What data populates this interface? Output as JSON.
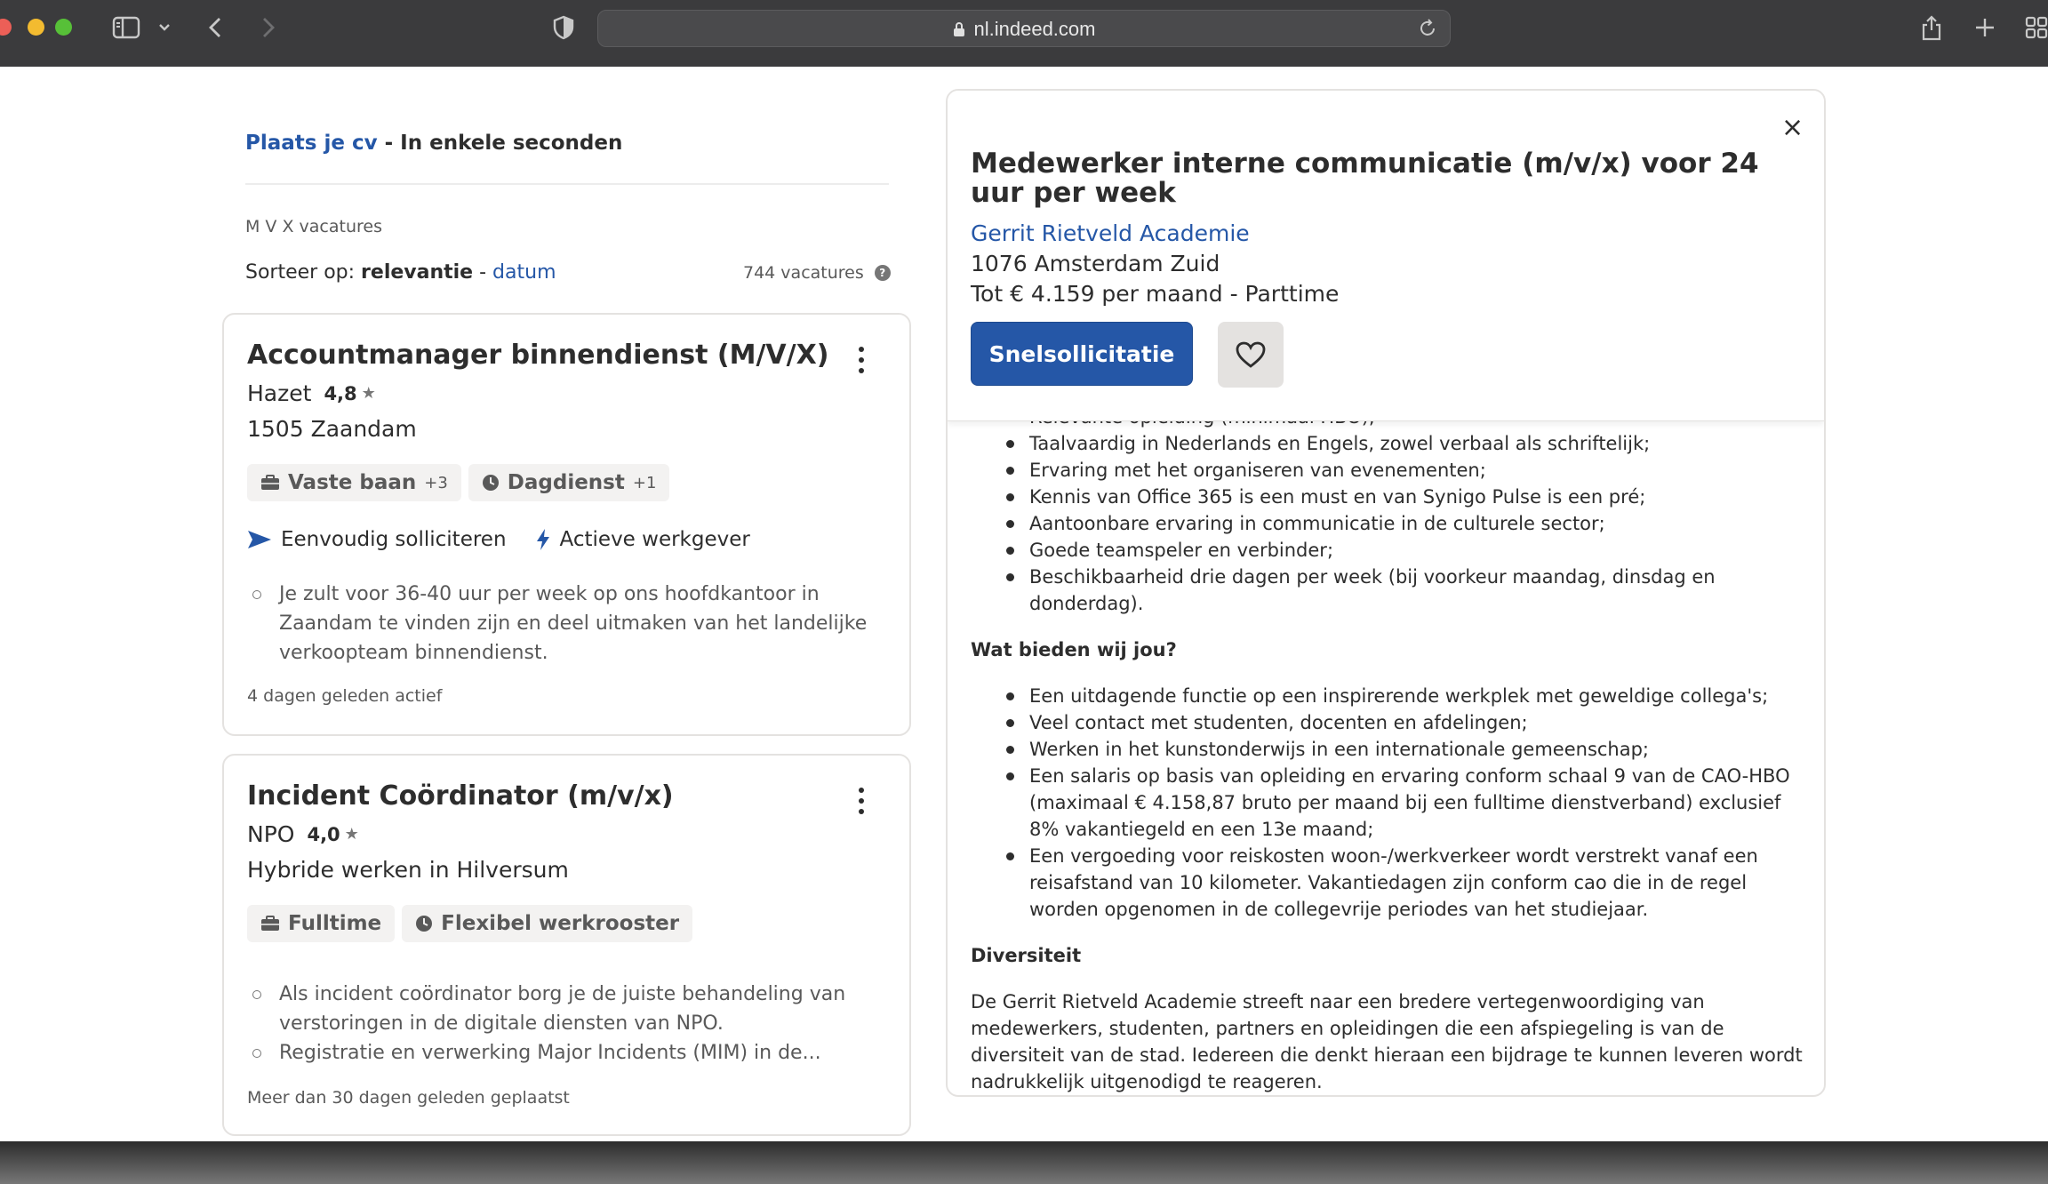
{
  "browser": {
    "url": "nl.indeed.com"
  },
  "left": {
    "post_cv_link": "Plaats je cv",
    "post_cv_rest": " - In enkele seconden",
    "search_label": "M V X vacatures",
    "sort_prefix": "Sorteer op:",
    "sort_relevance": "relevantie",
    "sort_sep": " - ",
    "sort_date": "datum",
    "job_count": "744 vacatures",
    "help": "?"
  },
  "jobs": [
    {
      "title": "Accountmanager binnendienst (M/V/X)",
      "company": "Hazet",
      "rating": "4,8",
      "location": "1505 Zaandam",
      "tag1": "Vaste baan",
      "tag1_extra": "+3",
      "tag2": "Dagdienst",
      "tag2_extra": "+1",
      "feature1": "Eenvoudig solliciteren",
      "feature2": "Actieve werkgever",
      "snippet1": "Je zult voor 36-40 uur per week op ons hoofdkantoor in Zaandam te vinden zijn en deel uitmaken van het landelijke verkoopteam binnendienst.",
      "posted": "4 dagen geleden actief"
    },
    {
      "title": "Incident Coördinator (m/v/x)",
      "company": "NPO",
      "rating": "4,0",
      "location": "Hybride werken in Hilversum",
      "tag1": "Fulltime",
      "tag2": "Flexibel werkrooster",
      "snippet1": "Als incident coördinator borg je de juiste behandeling van verstoringen in de digitale diensten van NPO.",
      "snippet2": "Registratie en verwerking Major Incidents (MIM) in de...",
      "posted": "Meer dan 30 dagen geleden geplaatst"
    }
  ],
  "detail": {
    "close": "×",
    "title": "Medewerker interne communicatie (m/v/x) voor 24 uur per week",
    "company": "Gerrit Rietveld Academie",
    "location": "1076 Amsterdam Zuid",
    "salary": "Tot € 4.159 per maand  - Parttime",
    "apply": "Snelsollicitatie",
    "requirements": [
      "Relevante opleiding (minimaal HBO);",
      "Taalvaardig in Nederlands en Engels, zowel verbaal als schriftelijk;",
      "Ervaring met het organiseren van evenementen;",
      "Kennis van Office 365 is een must en van Synigo Pulse is een pré;",
      "Aantoonbare ervaring in communicatie in de culturele sector;",
      "Goede teamspeler en verbinder;",
      "Beschikbaarheid drie dagen per week (bij voorkeur maandag, dinsdag en donderdag)."
    ],
    "offer_heading": "Wat bieden wij jou?",
    "offer": [
      "Een uitdagende functie op een inspirerende werkplek met geweldige collega's;",
      "Veel contact met studenten, docenten en afdelingen;",
      "Werken in het kunstonderwijs in een internationale gemeenschap;",
      "Een salaris op basis van opleiding en ervaring conform schaal 9 van de CAO-HBO (maximaal € 4.158,87 bruto per maand bij een fulltime dienstverband) exclusief 8% vakantiegeld en een 13e maand;",
      "Een vergoeding voor reiskosten woon-/werkverkeer wordt verstrekt vanaf een reisafstand van 10 kilometer. Vakantiedagen zijn conform cao die in de regel worden opgenomen in de collegevrije periodes van het studiejaar."
    ],
    "diversity_heading": "Diversiteit",
    "diversity_text": "De Gerrit Rietveld Academie streeft naar een bredere vertegenwoordiging van medewerkers, studenten, partners en opleidingen die een afspiegeling is van de diversiteit van de stad. Iedereen die denkt hieraan een bijdrage te kunnen leveren wordt nadrukkelijk uitgenodigd te reageren."
  },
  "colors": {
    "link": "#2557a7",
    "apply_bg": "#2557a7",
    "chrome": "#3b3b3d"
  }
}
